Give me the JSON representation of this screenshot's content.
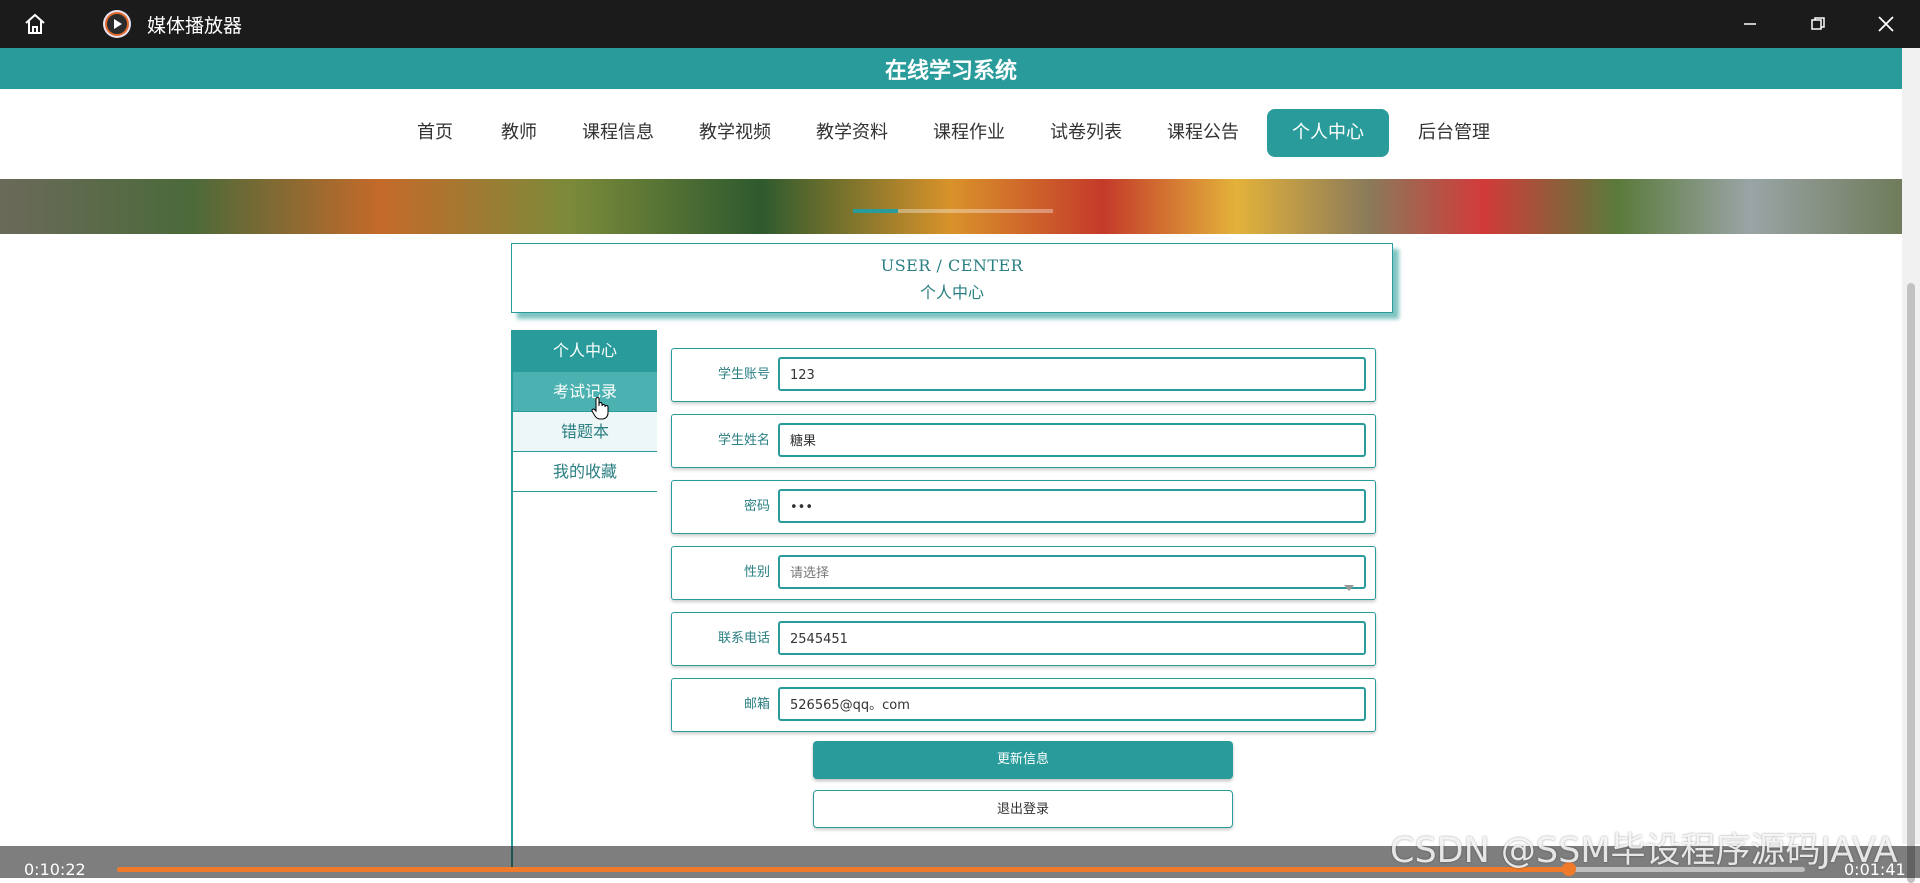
{
  "player": {
    "title": "媒体播放器",
    "current_time": "0:10:22",
    "remaining_time": "0:01:41",
    "progress_fraction": 0.86
  },
  "site": {
    "title": "在线学习系统",
    "nav": [
      {
        "label": "首页"
      },
      {
        "label": "教师"
      },
      {
        "label": "课程信息"
      },
      {
        "label": "教学视频"
      },
      {
        "label": "教学资料"
      },
      {
        "label": "课程作业"
      },
      {
        "label": "试卷列表"
      },
      {
        "label": "课程公告"
      },
      {
        "label": "个人中心"
      },
      {
        "label": "后台管理"
      }
    ],
    "active_nav": "个人中心",
    "accent_color": "#2a9b9b"
  },
  "user_center": {
    "title_en": "USER / CENTER",
    "title_cn": "个人中心"
  },
  "sidebar": {
    "items": [
      {
        "label": "个人中心"
      },
      {
        "label": "考试记录"
      },
      {
        "label": "错题本"
      },
      {
        "label": "我的收藏"
      }
    ]
  },
  "form": {
    "fields": [
      {
        "label": "学生账号",
        "value": "123"
      },
      {
        "label": "学生姓名",
        "value": "糖果"
      },
      {
        "label": "密码",
        "value": "•••"
      },
      {
        "label": "性别",
        "value": "",
        "placeholder": "请选择"
      },
      {
        "label": "联系电话",
        "value": "2545451"
      },
      {
        "label": "邮箱",
        "value": "526565@qq。com"
      }
    ],
    "update_button": "更新信息",
    "logout_button": "退出登录"
  },
  "watermark": "CSDN @SSM毕设程序源码JAVA"
}
